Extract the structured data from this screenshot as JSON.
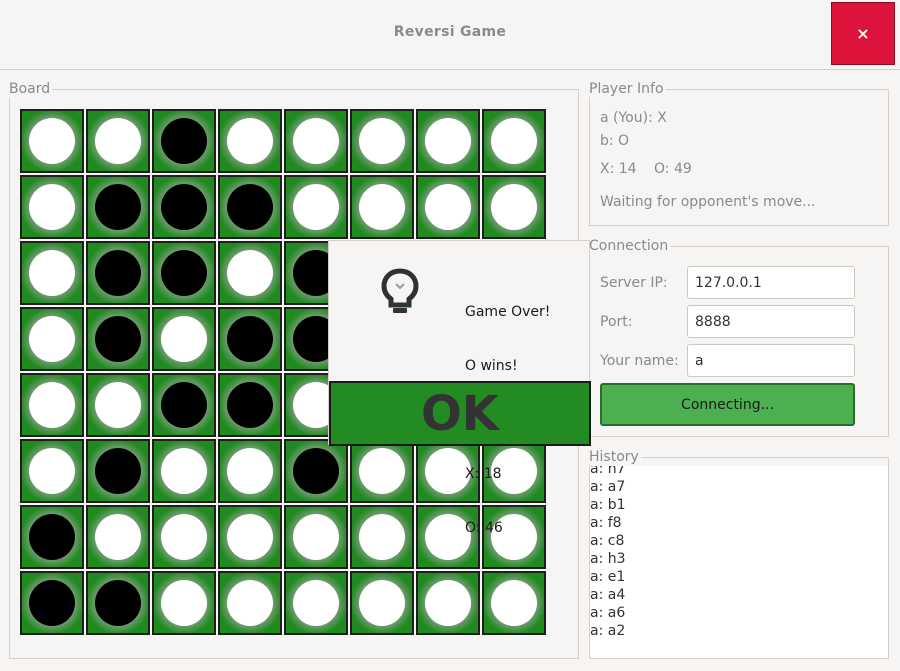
{
  "window": {
    "title": "Reversi Game",
    "close_label": "×"
  },
  "board": {
    "label": "Board",
    "rows": [
      [
        "W",
        "W",
        "B",
        "W",
        "W",
        "W",
        "W",
        "W"
      ],
      [
        "W",
        "B",
        "B",
        "B",
        "W",
        "W",
        "W",
        "W"
      ],
      [
        "W",
        "B",
        "B",
        "W",
        "B",
        "W",
        "W",
        "W"
      ],
      [
        "W",
        "B",
        "W",
        "B",
        "B",
        "W",
        "W",
        "W"
      ],
      [
        "W",
        "W",
        "B",
        "B",
        "W",
        "W",
        "W",
        "W"
      ],
      [
        "W",
        "B",
        "W",
        "W",
        "B",
        "W",
        "W",
        "W"
      ],
      [
        "B",
        "W",
        "W",
        "W",
        "W",
        "W",
        "W",
        "W"
      ],
      [
        "B",
        "B",
        "W",
        "W",
        "W",
        "W",
        "W",
        "W"
      ]
    ]
  },
  "player_info": {
    "label": "Player Info",
    "player_a": "a (You): X",
    "player_b": "b: O",
    "score_x": "X: 14",
    "score_o": "O: 49",
    "status": "Waiting for opponent's move..."
  },
  "connection": {
    "label": "Connection",
    "server_ip_label": "Server IP:",
    "server_ip_value": "127.0.0.1",
    "port_label": "Port:",
    "port_value": "8888",
    "name_label": "Your name:",
    "name_value": "a",
    "connect_button": "Connecting..."
  },
  "history": {
    "label": "History",
    "items": [
      "a: h7",
      "a: a7",
      "a: b1",
      "a: f8",
      "a: c8",
      "a: h3",
      "a: e1",
      "a: a4",
      "a: a6",
      "a: a2"
    ]
  },
  "dialog": {
    "line1": "Game Over!",
    "line2": "O wins!",
    "score_x": "X: 18",
    "score_o": "O: 46",
    "ok_label": "OK",
    "icon": "lightbulb-icon"
  }
}
